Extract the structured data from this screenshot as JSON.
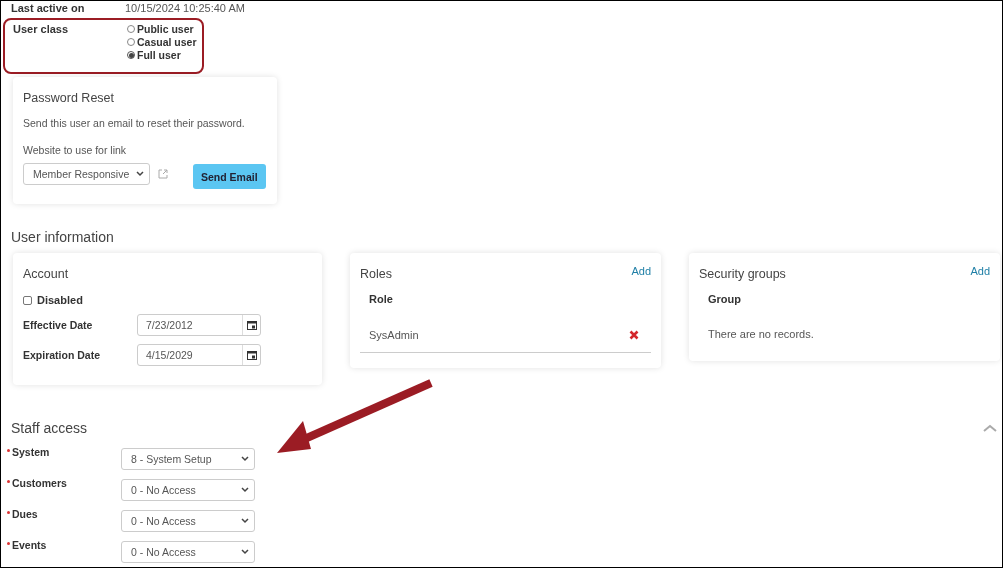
{
  "last_active": {
    "label": "Last active on",
    "value": "10/15/2024 10:25:40 AM"
  },
  "user_class": {
    "label": "User class",
    "options": [
      {
        "label": "Public user",
        "selected": false
      },
      {
        "label": "Casual user",
        "selected": false
      },
      {
        "label": "Full user",
        "selected": true
      }
    ]
  },
  "password_reset": {
    "title": "Password Reset",
    "description": "Send this user an email to reset their password.",
    "website_label": "Website to use for link",
    "website_value": "Member Responsive",
    "button": "Send Email"
  },
  "user_information": {
    "title": "User information"
  },
  "account": {
    "title": "Account",
    "disabled": {
      "label": "Disabled",
      "checked": false
    },
    "dates": [
      {
        "label": "Effective Date",
        "value": "7/23/2012"
      },
      {
        "label": "Expiration Date",
        "value": "4/15/2029"
      }
    ]
  },
  "roles": {
    "title": "Roles",
    "add": "Add",
    "column": "Role",
    "rows": [
      "SysAdmin"
    ]
  },
  "security_groups": {
    "title": "Security groups",
    "add": "Add",
    "column": "Group",
    "empty": "There are no records."
  },
  "staff_access": {
    "title": "Staff access",
    "expanded": true,
    "rows": [
      {
        "label": "System",
        "required": true,
        "value": "8 - System Setup"
      },
      {
        "label": "Customers",
        "required": true,
        "value": "0 - No Access"
      },
      {
        "label": "Dues",
        "required": true,
        "value": "0 - No Access"
      },
      {
        "label": "Events",
        "required": true,
        "value": "0 - No Access"
      }
    ]
  }
}
